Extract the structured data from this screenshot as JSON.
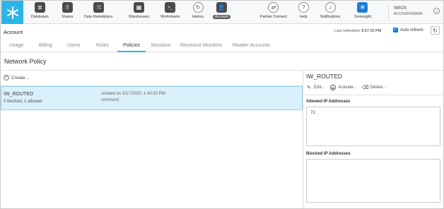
{
  "nav": {
    "items": [
      {
        "label": "Databases",
        "icon": "database-icon"
      },
      {
        "label": "Shares",
        "icon": "shares-icon"
      },
      {
        "label": "Data Marketplace",
        "icon": "marketplace-icon"
      },
      {
        "label": "Warehouses",
        "icon": "warehouse-icon"
      },
      {
        "label": "Worksheets",
        "icon": "worksheet-icon"
      },
      {
        "label": "History",
        "icon": "history-icon"
      },
      {
        "label": "Account",
        "icon": "account-icon"
      },
      {
        "label": "Partner Connect",
        "icon": "partner-connect-icon"
      },
      {
        "label": "Help",
        "icon": "help-icon"
      },
      {
        "label": "Notifications",
        "icon": "bell-icon"
      },
      {
        "label": "Snowsight",
        "icon": "snowsight-icon"
      }
    ],
    "active": "Account",
    "user_name": "IWICK",
    "user_role": "ACCOUNTADMIN"
  },
  "header": {
    "title": "Account",
    "last_refreshed_label": "Last refreshed:",
    "last_refreshed_time": "8:57:20 PM",
    "auto_refresh_label": "Auto refresh",
    "auto_refresh_checked": true
  },
  "tabs": [
    "Usage",
    "Billing",
    "Users",
    "Roles",
    "Policies",
    "Sessions",
    "Resource Monitors",
    "Reader Accounts"
  ],
  "active_tab": "Policies",
  "section_title": "Network Policy",
  "create_label": "Create...",
  "policy_row": {
    "name": "IW_ROUTED",
    "summary": "0 blocked, 1 allowed",
    "created": "created on 3/17/2020, 1:40:33 PM",
    "comment": "comment:"
  },
  "detail": {
    "title": "IW_ROUTED",
    "edit_label": "Edit...",
    "activate_label": "Activate...",
    "delete_label": "Delete...",
    "allowed_label": "Allowed IP Addresses",
    "allowed_value": "72.",
    "blocked_label": "Blocked IP Addresses"
  },
  "colors": {
    "brand": "#29b5e8",
    "selected_row": "#daf1fb",
    "snowsight": "#1a7fd6"
  }
}
